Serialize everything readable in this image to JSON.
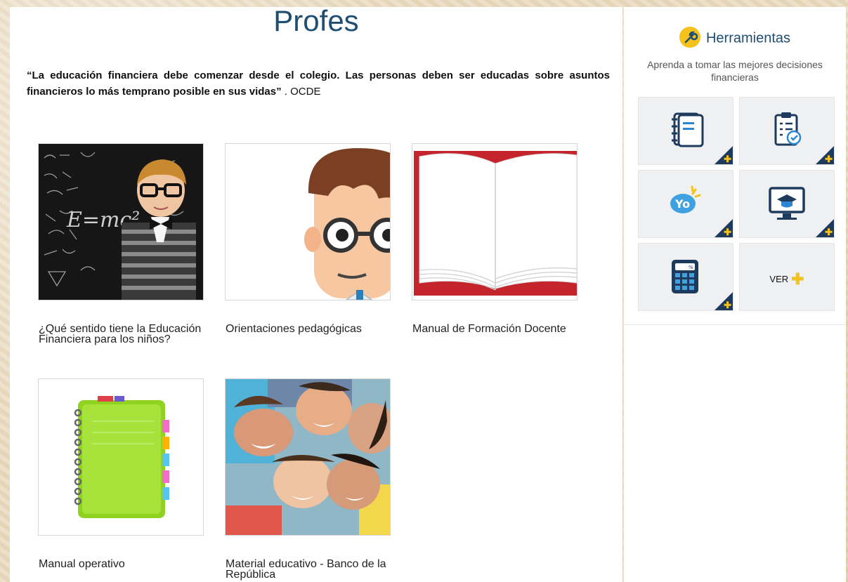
{
  "page": {
    "title": "Profes",
    "quote_text": "“La educación financiera debe comenzar desde el colegio. Las personas deben ser educadas sobre asuntos financieros lo más temprano posible en sus vidas”",
    "quote_source": " . OCDE"
  },
  "cards": [
    {
      "label": "¿Qué sentido tiene la Educación Financiera para los niños?",
      "image": "boy-chalkboard"
    },
    {
      "label": "Orientaciones pedagógicas",
      "image": "cartoon-teacher"
    },
    {
      "label": "Manual de Formación Docente",
      "image": "open-book"
    },
    {
      "label": "Manual operativo",
      "image": "green-notebook"
    },
    {
      "label": "Material educativo - Banco de la República",
      "image": "kids-circle"
    }
  ],
  "sidebar": {
    "title": "Herramientas",
    "subtitle": "Aprenda a tomar las mejores decisiones financieras",
    "tools": [
      {
        "icon": "notebook-icon"
      },
      {
        "icon": "checklist-icon"
      },
      {
        "icon": "yo-badge-icon"
      },
      {
        "icon": "graduation-screen-icon"
      },
      {
        "icon": "calculator-icon"
      },
      {
        "label": "VER",
        "icon": "plus-icon"
      }
    ]
  },
  "colors": {
    "brand_blue": "#1f4e73",
    "accent_yellow": "#f4c21b",
    "tile_bg": "#eef0f2",
    "corner_navy": "#1e3a5c"
  }
}
